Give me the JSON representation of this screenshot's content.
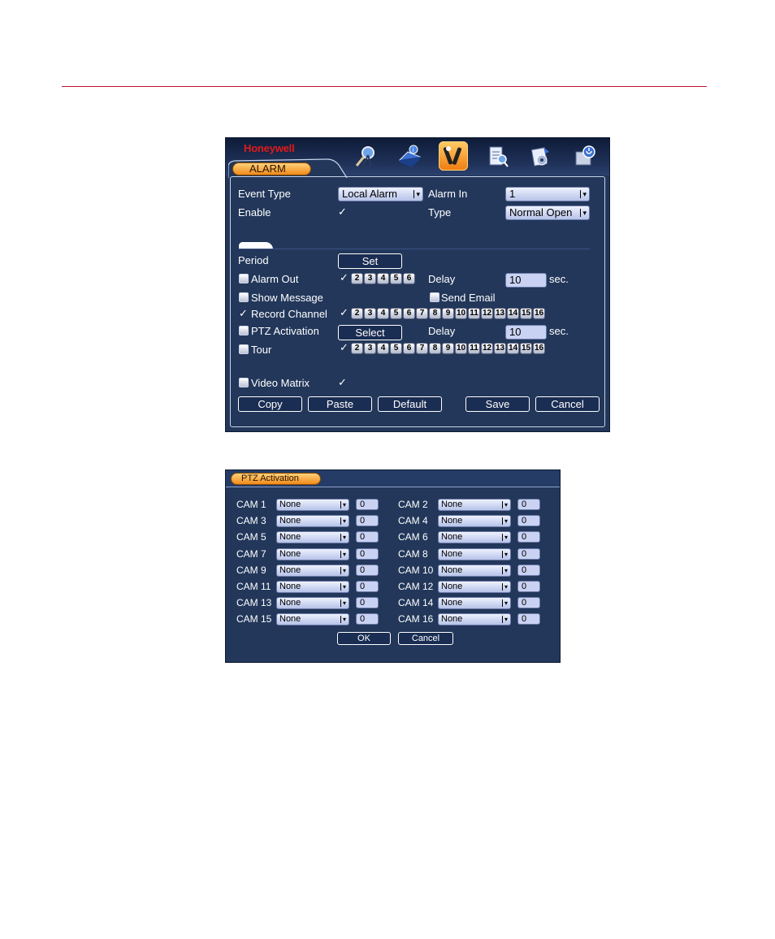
{
  "alarm_window": {
    "brand": "Honeywell",
    "tab_label": "ALARM",
    "menu_icons": [
      "search-icon",
      "info-book-icon",
      "tools-icon",
      "advanced-icon",
      "backup-icon",
      "shutdown-icon"
    ],
    "active_menu_index": 2,
    "event_type": {
      "label": "Event Type",
      "value": "Local Alarm"
    },
    "alarm_in": {
      "label": "Alarm In",
      "value": "1"
    },
    "enable": {
      "label": "Enable",
      "checked": true
    },
    "type": {
      "label": "Type",
      "value": "Normal Open"
    },
    "period": {
      "label": "Period",
      "button": "Set"
    },
    "alarm_out": {
      "label": "Alarm Out",
      "channels": [
        "1",
        "2",
        "3",
        "4",
        "5",
        "6"
      ],
      "checked_channels": [
        "1"
      ]
    },
    "delay1": {
      "label": "Delay",
      "value": "10",
      "unit": "sec."
    },
    "show_message": {
      "label": "Show Message"
    },
    "send_email": {
      "label": "Send Email"
    },
    "record_channel": {
      "label": "Record Channel",
      "channels": [
        "1",
        "2",
        "3",
        "4",
        "5",
        "6",
        "7",
        "8",
        "9",
        "10",
        "11",
        "12",
        "13",
        "14",
        "15",
        "16"
      ],
      "checked_channels": [
        "1"
      ]
    },
    "ptz_activation": {
      "label": "PTZ Activation",
      "button": "Select"
    },
    "delay2": {
      "label": "Delay",
      "value": "10",
      "unit": "sec."
    },
    "tour": {
      "label": "Tour",
      "channels": [
        "1",
        "2",
        "3",
        "4",
        "5",
        "6",
        "7",
        "8",
        "9",
        "10",
        "11",
        "12",
        "13",
        "14",
        "15",
        "16"
      ],
      "checked_channels": [
        "1"
      ]
    },
    "video_matrix": {
      "label": "Video Matrix"
    },
    "buttons": {
      "copy": "Copy",
      "paste": "Paste",
      "default": "Default",
      "save": "Save",
      "cancel": "Cancel"
    },
    "check_glyph": "✓",
    "dropdown_arrow": "▾"
  },
  "ptz_window": {
    "title": "PTZ Activation",
    "cams": [
      {
        "label": "CAM 1",
        "action": "None",
        "value": "0"
      },
      {
        "label": "CAM 2",
        "action": "None",
        "value": "0"
      },
      {
        "label": "CAM 3",
        "action": "None",
        "value": "0"
      },
      {
        "label": "CAM 4",
        "action": "None",
        "value": "0"
      },
      {
        "label": "CAM 5",
        "action": "None",
        "value": "0"
      },
      {
        "label": "CAM 6",
        "action": "None",
        "value": "0"
      },
      {
        "label": "CAM 7",
        "action": "None",
        "value": "0"
      },
      {
        "label": "CAM 8",
        "action": "None",
        "value": "0"
      },
      {
        "label": "CAM 9",
        "action": "None",
        "value": "0"
      },
      {
        "label": "CAM 10",
        "action": "None",
        "value": "0"
      },
      {
        "label": "CAM 11",
        "action": "None",
        "value": "0"
      },
      {
        "label": "CAM 12",
        "action": "None",
        "value": "0"
      },
      {
        "label": "CAM 13",
        "action": "None",
        "value": "0"
      },
      {
        "label": "CAM 14",
        "action": "None",
        "value": "0"
      },
      {
        "label": "CAM 15",
        "action": "None",
        "value": "0"
      },
      {
        "label": "CAM 16",
        "action": "None",
        "value": "0"
      }
    ],
    "buttons": {
      "ok": "OK",
      "cancel": "Cancel"
    }
  },
  "colors": {
    "rule": "#c8102e",
    "panel_bg": "#22375a",
    "accent_orange": "#f08a1a",
    "brand_red": "#e21a1a"
  }
}
